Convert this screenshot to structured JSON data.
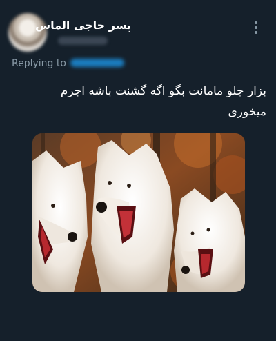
{
  "tweet": {
    "display_name": "پسر حاجی الماس",
    "reply_prefix": "Replying to",
    "text_line1": "بزار جلو مامانت بگو اگه گشنت باشه اجرم",
    "text_line2": "میخوری",
    "more_icon": "vertical-ellipsis-icon",
    "media": {
      "description_icon": "laughing-wolves-image",
      "colors": {
        "background": "#15202b",
        "secondary_text": "#8899a6",
        "link": "#1d9bf0"
      }
    }
  }
}
